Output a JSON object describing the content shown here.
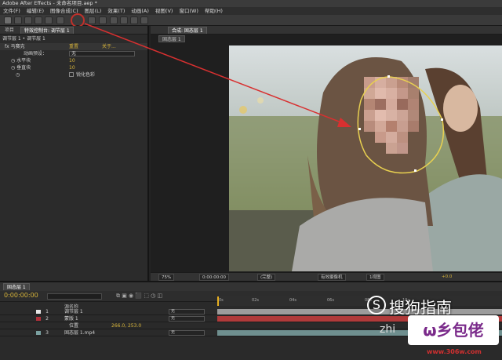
{
  "window": {
    "title": "Adobe After Effects - 未命名项目.aep *"
  },
  "menu": [
    "文件(F)",
    "编辑(E)",
    "图像合成(C)",
    "图层(L)",
    "效果(T)",
    "动画(A)",
    "视图(V)",
    "窗口(W)",
    "帮助(H)"
  ],
  "left_panel": {
    "tabs": [
      "项目",
      "特效控制台: 调节层 1"
    ],
    "header": "调节层 1 • 调节层 1",
    "effect_name": "马赛克",
    "reset": "重置",
    "about": "关于...",
    "anim_preset_label": "动画预设：",
    "anim_preset_value": "无",
    "horizontal_label": "水平块",
    "horizontal_value": "10",
    "vertical_label": "垂直块",
    "vertical_value": "10",
    "sharp_label": "锐化色彩"
  },
  "comp_panel": {
    "tab": "合成: 固态层 1",
    "subtab": "固态层 1",
    "zoom": "75%",
    "timecode": "0:00:00:00",
    "resolution": "(完整)",
    "camera": "有效摄像机",
    "views": "1视图",
    "exposure": "+0.0"
  },
  "timeline": {
    "tab": "固态层 1",
    "timecode": "0:00:00:00",
    "col_header": "源名称",
    "ruler": [
      "0s",
      "02s",
      "04s",
      "06s",
      "08s",
      "10s"
    ],
    "layers": [
      {
        "num": "1",
        "name": "调节层 1",
        "mode": "无",
        "color": "#e6e6e6",
        "bar": "#9c9c9c"
      },
      {
        "num": "2",
        "name": "蒙版 1",
        "mode": "无",
        "color": "#b0303a",
        "bar": "#b03a3a"
      },
      {
        "num": "",
        "name": "位置",
        "mode": "",
        "value": "266.0, 253.0",
        "color": "",
        "bar": ""
      },
      {
        "num": "3",
        "name": "固态层 1.mp4",
        "mode": "无",
        "color": "#7aa0a0",
        "bar": "#6f8f8f"
      }
    ]
  },
  "watermark": {
    "text1": "搜狗指南",
    "text2": "zhi",
    "text3": "www.306w.com"
  },
  "icons": [
    "select-tool-icon",
    "hand-tool-icon",
    "zoom-tool-icon",
    "rotate-tool-icon",
    "camera-tool-icon",
    "ellipse-mask-tool-icon",
    "pen-tool-icon",
    "text-tool-icon",
    "brush-tool-icon",
    "stamp-tool-icon",
    "eraser-tool-icon",
    "puppet-tool-icon"
  ]
}
